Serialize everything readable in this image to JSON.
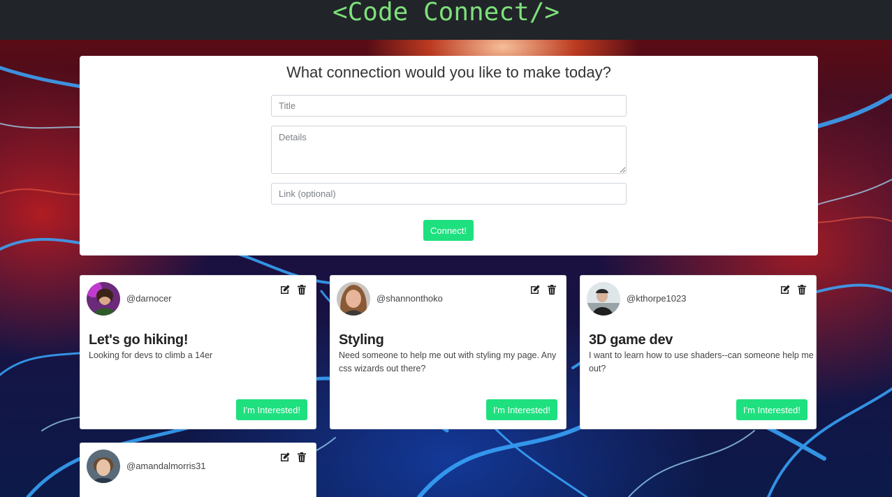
{
  "header": {
    "brand": "<Code Connect/>"
  },
  "form": {
    "heading": "What connection would you like to make today?",
    "title_placeholder": "Title",
    "details_placeholder": "Details",
    "link_placeholder": "Link (optional)",
    "submit_label": "Connect!"
  },
  "posts": [
    {
      "username": "@darnocer",
      "title": "Let's go hiking!",
      "description": "Looking for devs to climb a 14er",
      "button_label": "I'm Interested!"
    },
    {
      "username": "@shannonthoko",
      "title": "Styling",
      "description": "Need someone to help me out with styling my page. Any css wizards out there?",
      "button_label": "I'm Interested!"
    },
    {
      "username": "@kthorpe1023",
      "title": "3D game dev",
      "description": "I want to learn how to use shaders--can someone help me out?",
      "button_label": "I'm Interested!"
    },
    {
      "username": "@amandalmorris31",
      "title": "",
      "description": "",
      "button_label": ""
    }
  ],
  "colors": {
    "brand_green": "#7ee07a",
    "button_green": "#1ee07f",
    "topbar": "#212529"
  },
  "icons": [
    "edit-icon",
    "trash-icon",
    "avatar"
  ]
}
